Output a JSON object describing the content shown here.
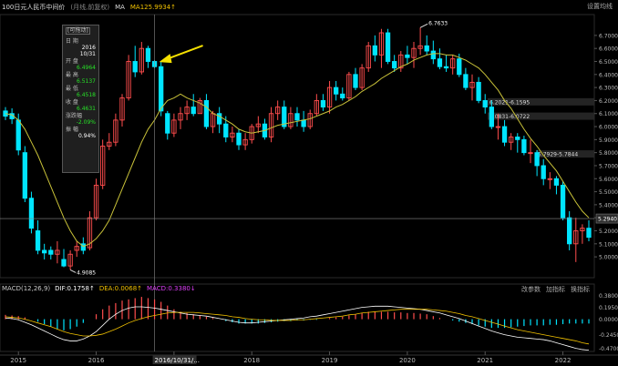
{
  "header": {
    "title": "100日元人民币中间价",
    "subtitle": "(月线,前复权)",
    "ma_label": "MA",
    "ma_value": "MA125.9934↑",
    "settings": "设置均线"
  },
  "tooltip": {
    "title": "[可拖动]",
    "date_label": "日 期",
    "year": "2016",
    "monthday": "10/31",
    "open_label": "开 盘",
    "open": "6.4964",
    "high_label": "最 高",
    "high": "6.5137",
    "low_label": "最 低",
    "low": "6.4518",
    "close_label": "收 盘",
    "close": "6.4631",
    "chg_label": "涨跌幅",
    "chg": "-2.09%",
    "amp_label": "振 幅",
    "amp": "0.94%"
  },
  "crosshair": {
    "date_label": "2016/10/31/...",
    "price_label": "5.2940"
  },
  "macd": {
    "label": "MACD(12,26,9)",
    "dif": "DIF:0.1758↑",
    "dea": "DEA:0.0068↑",
    "macd": "MACD:0.3380↓",
    "tools": [
      "改参数",
      "加指标",
      "换指标"
    ]
  },
  "colors": {
    "up": "#ff4d4d",
    "down": "#00e5ff",
    "ma": "#c9c239",
    "dif": "#ffffff",
    "dea": "#f2c200",
    "arrow": "#f5e000"
  },
  "chart_data": {
    "type": "candlestick",
    "x": [
      "2014-11",
      "2014-12",
      "2015-01",
      "2015-02",
      "2015-03",
      "2015-04",
      "2015-05",
      "2015-06",
      "2015-07",
      "2015-08",
      "2015-09",
      "2015-10",
      "2015-11",
      "2015-12",
      "2016-01",
      "2016-02",
      "2016-03",
      "2016-04",
      "2016-05",
      "2016-06",
      "2016-07",
      "2016-08",
      "2016-09",
      "2016-10",
      "2016-11",
      "2016-12",
      "2017-01",
      "2017-02",
      "2017-03",
      "2017-04",
      "2017-05",
      "2017-06",
      "2017-07",
      "2017-08",
      "2017-09",
      "2017-10",
      "2017-11",
      "2017-12",
      "2018-01",
      "2018-02",
      "2018-03",
      "2018-04",
      "2018-05",
      "2018-06",
      "2018-07",
      "2018-08",
      "2018-09",
      "2018-10",
      "2018-11",
      "2018-12",
      "2019-01",
      "2019-02",
      "2019-03",
      "2019-04",
      "2019-05",
      "2019-06",
      "2019-07",
      "2019-08",
      "2019-09",
      "2019-10",
      "2019-11",
      "2019-12",
      "2020-01",
      "2020-02",
      "2020-03",
      "2020-04",
      "2020-05",
      "2020-06",
      "2020-07",
      "2020-08",
      "2020-09",
      "2020-10",
      "2020-11",
      "2020-12",
      "2021-01",
      "2021-02",
      "2021-03",
      "2021-04",
      "2021-05",
      "2021-06",
      "2021-07",
      "2021-08",
      "2021-09",
      "2021-10",
      "2021-11",
      "2021-12",
      "2022-01",
      "2022-02",
      "2022-03",
      "2022-04",
      "2022-05"
    ],
    "open": [
      6.12,
      6.1,
      6.05,
      5.8,
      5.45,
      5.2,
      5.05,
      5.05,
      5.02,
      4.98,
      4.93,
      5.05,
      5.1,
      5.07,
      5.3,
      5.55,
      5.85,
      5.88,
      6.05,
      6.22,
      6.5,
      6.42,
      6.6,
      6.5,
      6.46,
      6.1,
      5.95,
      6.05,
      6.1,
      6.15,
      6.1,
      6.2,
      6.0,
      6.1,
      6.02,
      5.92,
      5.95,
      5.86,
      5.9,
      6.0,
      6.02,
      5.92,
      6.1,
      6.15,
      6.0,
      6.1,
      6.05,
      6.0,
      6.1,
      6.2,
      6.15,
      6.3,
      6.25,
      6.22,
      6.4,
      6.3,
      6.45,
      6.62,
      6.55,
      6.72,
      6.5,
      6.45,
      6.55,
      6.53,
      6.6,
      6.62,
      6.58,
      6.52,
      6.46,
      6.45,
      6.52,
      6.4,
      6.3,
      6.34,
      6.2,
      6.15,
      6.0,
      6.0,
      5.88,
      5.92,
      5.9,
      5.8,
      5.8,
      5.7,
      5.6,
      5.6,
      5.55,
      5.3,
      5.1,
      5.2,
      5.22
    ],
    "high": [
      6.15,
      6.14,
      6.1,
      5.85,
      5.5,
      5.28,
      5.1,
      5.08,
      5.12,
      5.06,
      5.05,
      5.12,
      5.15,
      5.35,
      5.6,
      5.9,
      5.95,
      6.1,
      6.25,
      6.55,
      6.62,
      6.65,
      6.62,
      6.51,
      6.5,
      6.12,
      6.1,
      6.15,
      6.2,
      6.25,
      6.22,
      6.25,
      6.12,
      6.15,
      6.08,
      6.0,
      5.98,
      5.95,
      6.02,
      6.08,
      6.06,
      6.15,
      6.2,
      6.2,
      6.15,
      6.15,
      6.12,
      6.13,
      6.25,
      6.25,
      6.35,
      6.35,
      6.3,
      6.42,
      6.45,
      6.48,
      6.65,
      6.7,
      6.75,
      6.75,
      6.55,
      6.58,
      6.62,
      6.65,
      6.76,
      6.7,
      6.66,
      6.6,
      6.55,
      6.55,
      6.56,
      6.45,
      6.4,
      6.38,
      6.25,
      6.2,
      6.1,
      6.05,
      5.95,
      5.95,
      5.93,
      5.9,
      5.82,
      5.75,
      5.65,
      5.62,
      5.58,
      5.35,
      5.3,
      5.25,
      5.28
    ],
    "low": [
      6.05,
      6.02,
      5.78,
      5.42,
      5.18,
      5.02,
      4.98,
      4.98,
      4.95,
      4.92,
      4.9,
      5.0,
      5.02,
      5.05,
      5.28,
      5.52,
      5.82,
      5.85,
      6.0,
      6.2,
      6.38,
      6.4,
      6.45,
      6.45,
      6.08,
      5.9,
      5.92,
      5.98,
      6.05,
      6.08,
      6.1,
      5.98,
      5.95,
      5.95,
      5.88,
      5.88,
      5.82,
      5.82,
      5.87,
      5.95,
      5.9,
      5.88,
      6.05,
      5.98,
      5.98,
      6.0,
      5.96,
      5.98,
      6.08,
      6.12,
      6.1,
      6.2,
      6.2,
      6.2,
      6.28,
      6.28,
      6.42,
      6.5,
      6.45,
      6.48,
      6.42,
      6.42,
      6.48,
      6.45,
      6.55,
      6.55,
      6.48,
      6.44,
      6.42,
      6.4,
      6.38,
      6.28,
      6.2,
      6.18,
      6.1,
      5.98,
      5.9,
      5.85,
      5.82,
      5.8,
      5.78,
      5.72,
      5.62,
      5.55,
      5.52,
      5.48,
      5.28,
      5.05,
      4.96,
      5.1,
      5.12
    ],
    "close": [
      6.08,
      6.06,
      5.82,
      5.45,
      5.22,
      5.05,
      5.03,
      5.02,
      5.05,
      4.93,
      5.02,
      5.08,
      5.05,
      5.3,
      5.55,
      5.85,
      5.88,
      6.05,
      6.22,
      6.5,
      6.42,
      6.6,
      6.5,
      6.46,
      6.12,
      5.95,
      6.05,
      6.1,
      6.15,
      6.1,
      6.2,
      6.0,
      6.1,
      6.02,
      5.92,
      5.95,
      5.86,
      5.9,
      6.0,
      6.02,
      5.92,
      6.1,
      6.15,
      6.0,
      6.1,
      6.05,
      6.0,
      6.1,
      6.2,
      6.15,
      6.3,
      6.25,
      6.22,
      6.4,
      6.3,
      6.45,
      6.62,
      6.55,
      6.72,
      6.5,
      6.45,
      6.55,
      6.53,
      6.6,
      6.62,
      6.58,
      6.52,
      6.46,
      6.45,
      6.52,
      6.4,
      6.3,
      6.34,
      6.2,
      6.15,
      6.0,
      6.0,
      5.88,
      5.92,
      5.9,
      5.8,
      5.8,
      5.7,
      5.6,
      5.6,
      5.55,
      5.3,
      5.1,
      5.2,
      5.22,
      5.15
    ],
    "ma": [
      6.1,
      6.09,
      6.05,
      5.98,
      5.88,
      5.78,
      5.66,
      5.54,
      5.42,
      5.3,
      5.2,
      5.12,
      5.08,
      5.1,
      5.14,
      5.2,
      5.28,
      5.4,
      5.52,
      5.64,
      5.76,
      5.88,
      5.98,
      6.05,
      6.14,
      6.2,
      6.22,
      6.25,
      6.22,
      6.2,
      6.18,
      6.15,
      6.1,
      6.08,
      6.05,
      6.02,
      5.98,
      5.96,
      5.95,
      5.96,
      5.97,
      5.99,
      6.01,
      6.02,
      6.03,
      6.04,
      6.05,
      6.06,
      6.08,
      6.1,
      6.12,
      6.15,
      6.17,
      6.2,
      6.23,
      6.27,
      6.3,
      6.33,
      6.37,
      6.4,
      6.43,
      6.46,
      6.48,
      6.51,
      6.53,
      6.55,
      6.56,
      6.56,
      6.55,
      6.55,
      6.53,
      6.51,
      6.48,
      6.45,
      6.4,
      6.34,
      6.28,
      6.2,
      6.14,
      6.06,
      5.98,
      5.91,
      5.85,
      5.78,
      5.72,
      5.66,
      5.58,
      5.5,
      5.42,
      5.35,
      5.3
    ],
    "macd_bar": [
      0.07,
      0.06,
      0.05,
      0.03,
      0.0,
      -0.04,
      -0.08,
      -0.12,
      -0.16,
      -0.18,
      -0.16,
      -0.12,
      -0.06,
      0.0,
      0.08,
      0.16,
      0.22,
      0.26,
      0.3,
      0.32,
      0.34,
      0.36,
      0.34,
      0.32,
      0.28,
      0.22,
      0.16,
      0.12,
      0.1,
      0.08,
      0.06,
      0.04,
      0.02,
      0.0,
      -0.03,
      -0.05,
      -0.07,
      -0.07,
      -0.07,
      -0.07,
      -0.06,
      -0.05,
      -0.04,
      -0.03,
      -0.03,
      -0.02,
      -0.02,
      -0.01,
      -0.01,
      0.0,
      0.02,
      0.03,
      0.04,
      0.06,
      0.08,
      0.1,
      0.12,
      0.12,
      0.12,
      0.12,
      0.11,
      0.11,
      0.1,
      0.1,
      0.09,
      0.08,
      0.05,
      0.02,
      0.0,
      -0.02,
      -0.04,
      -0.06,
      -0.08,
      -0.1,
      -0.12,
      -0.14,
      -0.14,
      -0.14,
      -0.13,
      -0.12,
      -0.11,
      -0.1,
      -0.1,
      -0.1,
      -0.09,
      -0.09,
      -0.08,
      -0.07,
      -0.07,
      -0.07,
      -0.07
    ],
    "dif": [
      0.02,
      0.01,
      -0.01,
      -0.05,
      -0.09,
      -0.14,
      -0.19,
      -0.24,
      -0.29,
      -0.33,
      -0.35,
      -0.35,
      -0.32,
      -0.27,
      -0.2,
      -0.1,
      0.0,
      0.08,
      0.14,
      0.18,
      0.2,
      0.2,
      0.19,
      0.18,
      0.16,
      0.14,
      0.12,
      0.1,
      0.08,
      0.07,
      0.06,
      0.05,
      0.03,
      0.01,
      -0.01,
      -0.03,
      -0.05,
      -0.06,
      -0.06,
      -0.05,
      -0.04,
      -0.03,
      -0.02,
      -0.01,
      0.0,
      0.01,
      0.02,
      0.04,
      0.05,
      0.07,
      0.09,
      0.11,
      0.13,
      0.15,
      0.17,
      0.19,
      0.2,
      0.21,
      0.21,
      0.21,
      0.2,
      0.19,
      0.18,
      0.17,
      0.16,
      0.14,
      0.12,
      0.1,
      0.07,
      0.04,
      0.01,
      -0.03,
      -0.07,
      -0.11,
      -0.15,
      -0.19,
      -0.22,
      -0.25,
      -0.27,
      -0.29,
      -0.3,
      -0.31,
      -0.32,
      -0.33,
      -0.35,
      -0.38,
      -0.41,
      -0.44,
      -0.47,
      -0.49,
      -0.5
    ],
    "dea": [
      0.04,
      0.03,
      0.02,
      0.0,
      -0.03,
      -0.06,
      -0.09,
      -0.12,
      -0.16,
      -0.2,
      -0.23,
      -0.25,
      -0.27,
      -0.27,
      -0.26,
      -0.24,
      -0.2,
      -0.16,
      -0.11,
      -0.06,
      -0.02,
      0.01,
      0.04,
      0.06,
      0.08,
      0.1,
      0.11,
      0.11,
      0.11,
      0.11,
      0.1,
      0.09,
      0.08,
      0.07,
      0.06,
      0.04,
      0.03,
      0.01,
      0.0,
      -0.01,
      -0.01,
      -0.02,
      -0.02,
      -0.02,
      -0.02,
      -0.01,
      -0.01,
      0.0,
      0.01,
      0.02,
      0.03,
      0.04,
      0.05,
      0.07,
      0.08,
      0.1,
      0.11,
      0.12,
      0.13,
      0.14,
      0.15,
      0.16,
      0.16,
      0.16,
      0.16,
      0.16,
      0.15,
      0.14,
      0.13,
      0.11,
      0.09,
      0.06,
      0.04,
      0.01,
      -0.02,
      -0.05,
      -0.08,
      -0.11,
      -0.14,
      -0.17,
      -0.19,
      -0.21,
      -0.23,
      -0.25,
      -0.27,
      -0.29,
      -0.31,
      -0.33,
      -0.35,
      -0.38,
      -0.4
    ],
    "y_ticks": [
      "6.7000",
      "6.6000",
      "6.5000",
      "6.4000",
      "6.3000",
      "6.2000",
      "6.1000",
      "6.0000",
      "5.9000",
      "5.8000",
      "5.7000",
      "5.6000",
      "5.5000",
      "5.4000",
      "5.3000",
      "5.2000",
      "5.1000",
      "5.0000"
    ],
    "x_tick_labels": [
      "2015",
      "2016",
      "2017",
      "2018",
      "2019",
      "2020",
      "2021",
      "2022"
    ],
    "macd_y_ticks": [
      "0.3800",
      "0.1950",
      "0.0000",
      "-0.2450",
      "-0.4700"
    ],
    "ylim": [
      4.84,
      6.86
    ],
    "macd_ylim": [
      -0.52,
      0.42
    ],
    "annotations": {
      "high_label": "6.7633",
      "low_label": "4.9085",
      "level1": "6.2021-6.1595",
      "level2": "6.0831-6.0722",
      "level3": "5.7929-5.7844"
    }
  }
}
